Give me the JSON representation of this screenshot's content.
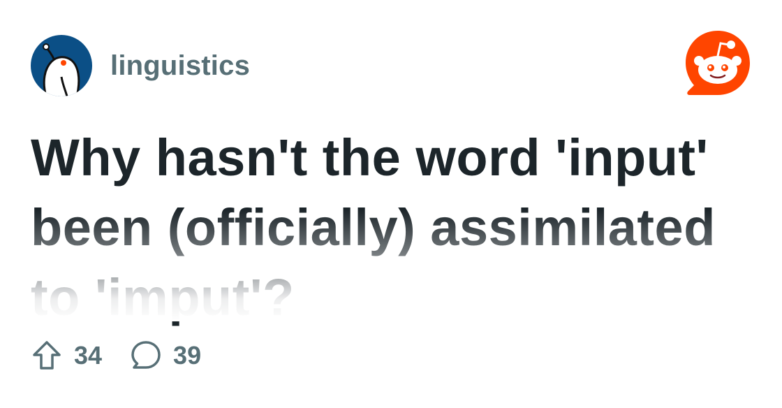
{
  "community": {
    "name": "linguistics",
    "avatar_icon": "snoo-avatar-icon"
  },
  "brand": {
    "logo_icon": "reddit-logo-icon",
    "color": "#ff4500"
  },
  "post": {
    "title": "Why hasn't the word 'input' been (officially) assimilated to 'imput'?"
  },
  "stats": {
    "upvotes": "34",
    "upvote_icon": "upvote-arrow-icon",
    "comments": "39",
    "comment_icon": "comment-bubble-icon"
  },
  "colors": {
    "title_text": "#1c252a",
    "muted_text": "#576f76",
    "avatar_bg": "#0b4f86"
  }
}
